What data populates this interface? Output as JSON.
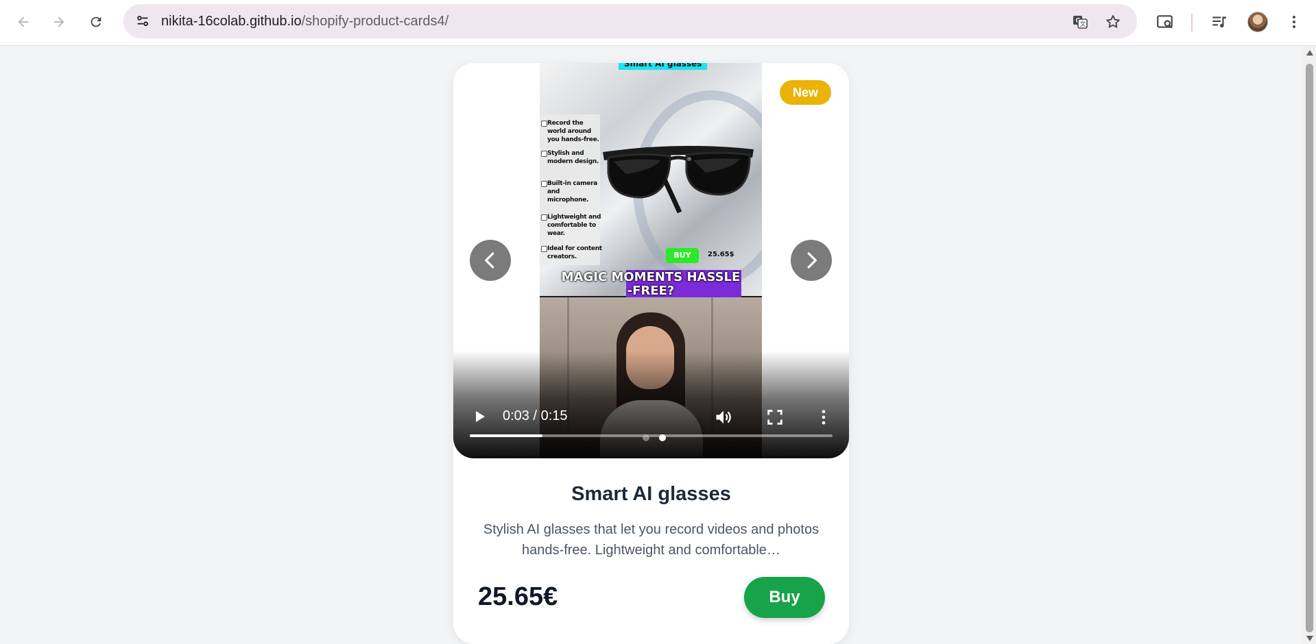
{
  "browser": {
    "url_domain": "nikita-16colab.github.io",
    "url_path": "/shopify-product-cards4/",
    "icons": [
      "back-arrow-icon",
      "forward-arrow-icon",
      "reload-icon",
      "site-info-icon",
      "translate-icon",
      "bookmark-star-icon",
      "search-lens-icon",
      "media-controls-icon",
      "profile-avatar",
      "more-vert-icon"
    ]
  },
  "card": {
    "badge": "New",
    "title": "Smart AI glasses",
    "description": "Stylish AI glasses that let you record videos and photos hands-free. Lightweight and comfortable…",
    "price": "25.65€",
    "buy_label": "Buy",
    "carousel": {
      "dots": 2,
      "active_dot": 2
    },
    "video": {
      "time": "0:03 / 0:15",
      "progress_fraction": 0.2,
      "frame_text": {
        "top_caption": "Smart AI glasses",
        "features": [
          "Record the world around you hands-free.",
          "Stylish and modern design.",
          "Built-in camera and microphone.",
          "Lightweight and comfortable to wear.",
          "Ideal for content creators."
        ],
        "buy_chip": "BUY",
        "price_text": "25.65$",
        "headline_line1": "MAGIC MOMENTS HASSLE",
        "headline_line2": "-FREE?"
      }
    }
  },
  "colors": {
    "badge": "#eab308",
    "buy_button": "#16a34a",
    "page_background": "#f3f4f6",
    "omnibox": "#f0e6ef"
  }
}
